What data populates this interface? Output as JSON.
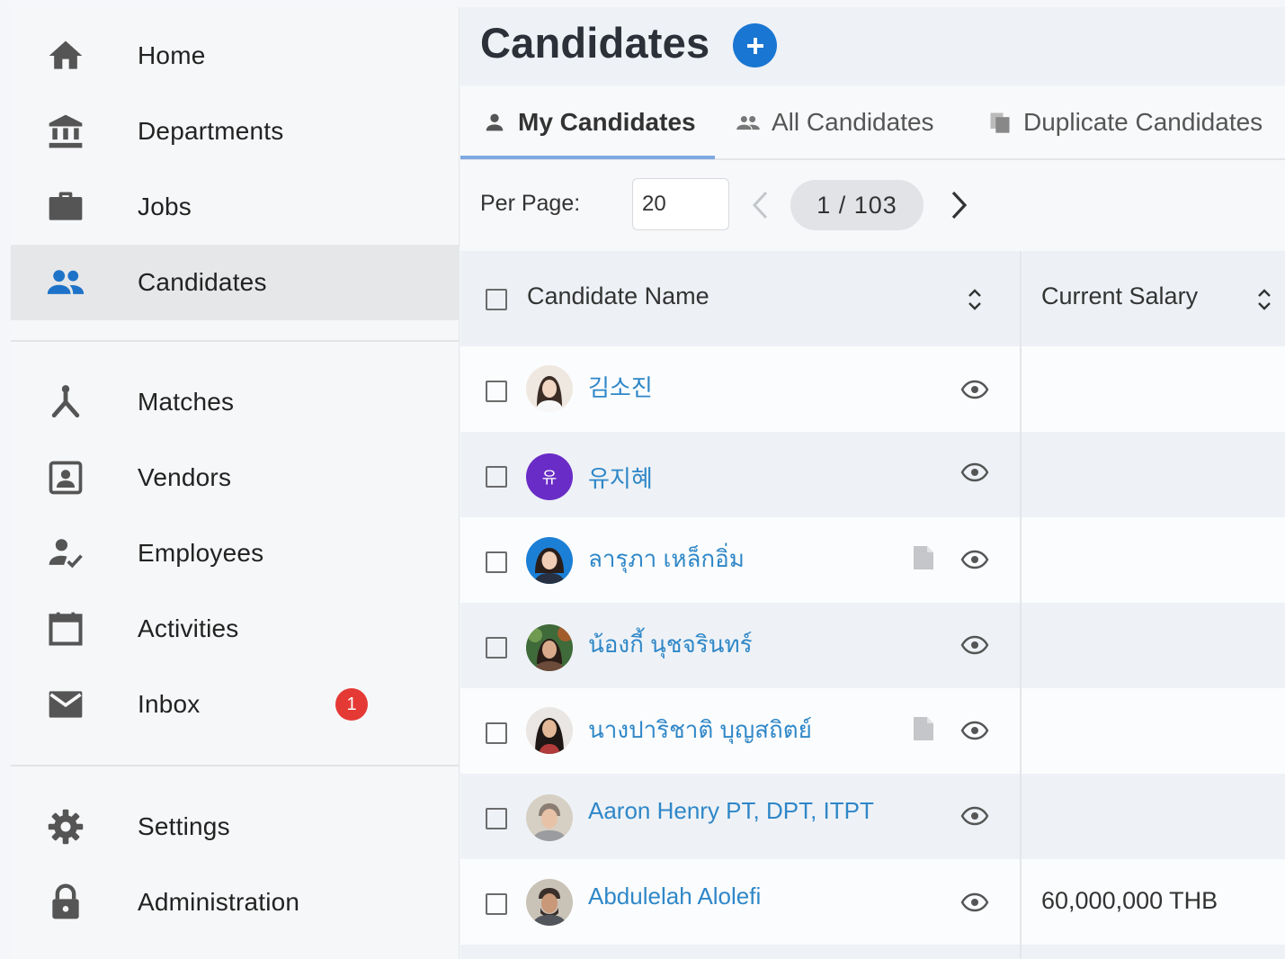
{
  "sidebar": {
    "items": [
      {
        "label": "Home",
        "icon": "home-icon"
      },
      {
        "label": "Departments",
        "icon": "bank-icon"
      },
      {
        "label": "Jobs",
        "icon": "briefcase-icon"
      },
      {
        "label": "Candidates",
        "icon": "people-icon",
        "active": true
      },
      {
        "label": "Matches",
        "icon": "merge-icon"
      },
      {
        "label": "Vendors",
        "icon": "contact-card-icon"
      },
      {
        "label": "Employees",
        "icon": "person-check-icon"
      },
      {
        "label": "Activities",
        "icon": "calendar-icon"
      },
      {
        "label": "Inbox",
        "icon": "mail-icon",
        "badge": "1"
      },
      {
        "label": "Settings",
        "icon": "gear-icon"
      },
      {
        "label": "Administration",
        "icon": "lock-icon"
      }
    ]
  },
  "header": {
    "title": "Candidates",
    "add_icon": "plus-circle-icon"
  },
  "tabs": [
    {
      "label": "My Candidates",
      "icon": "person-icon",
      "active": true
    },
    {
      "label": "All Candidates",
      "icon": "people-icon"
    },
    {
      "label": "Duplicate Candidates",
      "icon": "copy-icon"
    }
  ],
  "pager": {
    "per_page_label": "Per Page:",
    "per_page_value": "20",
    "page_indicator": "1 / 103"
  },
  "table": {
    "columns": [
      "Candidate Name",
      "Current Salary"
    ],
    "rows": [
      {
        "name": "김소진",
        "avatar": "photo",
        "has_document": false,
        "salary": ""
      },
      {
        "name": "유지혜",
        "avatar": "initial",
        "avatar_initial": "유",
        "has_document": false,
        "salary": ""
      },
      {
        "name": "ลารุภา เหล็กอิ่ม",
        "avatar": "photo",
        "has_document": true,
        "salary": ""
      },
      {
        "name": "น้องกี้ นุชจรินทร์",
        "avatar": "photo",
        "has_document": false,
        "salary": ""
      },
      {
        "name": "นางปาริชาติ บุญสถิตย์",
        "avatar": "photo",
        "has_document": true,
        "salary": ""
      },
      {
        "name": "Aaron Henry PT, DPT, ITPT",
        "avatar": "photo",
        "has_document": false,
        "salary": ""
      },
      {
        "name": "Abdulelah Alolefi",
        "avatar": "photo",
        "has_document": false,
        "salary": "60,000,000 THB"
      }
    ]
  },
  "colors": {
    "accent": "#1976d2",
    "link": "#2f87c8",
    "badge": "#e53935",
    "avatar_initial_bg": "#6a2cc6"
  }
}
